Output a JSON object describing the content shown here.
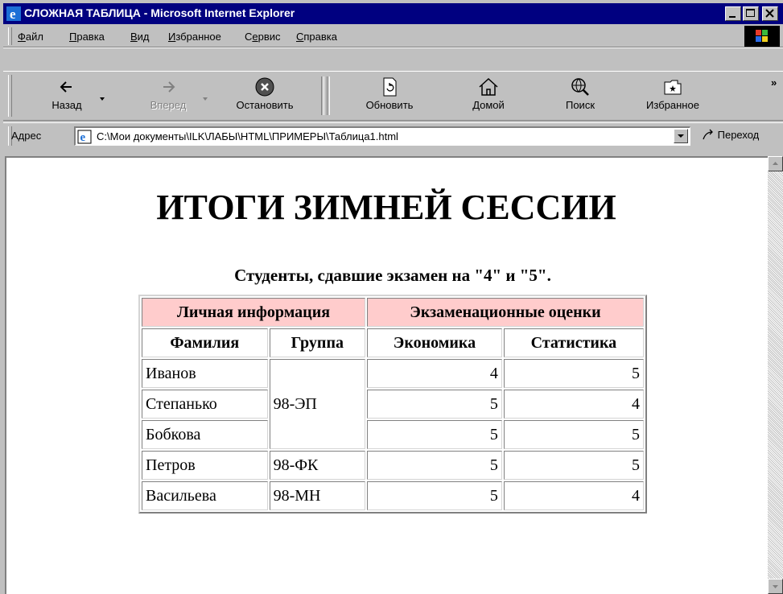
{
  "window": {
    "title": "СЛОЖНАЯ ТАБЛИЦА - Microsoft Internet Explorer"
  },
  "menu": [
    {
      "pre": "",
      "u": "Ф",
      "post": "айл"
    },
    {
      "pre": "",
      "u": "П",
      "post": "равка"
    },
    {
      "pre": "",
      "u": "В",
      "post": "ид"
    },
    {
      "pre": "",
      "u": "И",
      "post": "збранное"
    },
    {
      "pre": "С",
      "u": "е",
      "post": "рвис"
    },
    {
      "pre": "",
      "u": "С",
      "post": "правка"
    }
  ],
  "toolbar": {
    "back": "Назад",
    "forward": "Вперед",
    "stop": "Остановить",
    "refresh": "Обновить",
    "home": "Домой",
    "search": "Поиск",
    "favorites": "Избранное",
    "more": "»"
  },
  "address": {
    "label": "Адрес",
    "value": "C:\\Мои документы\\ILK\\ЛАБЫ\\HTML\\ПРИМЕРЫ\\Таблица1.html",
    "go": "Переход"
  },
  "page": {
    "heading": "ИТОГИ ЗИМНЕЙ СЕССИИ",
    "caption": "Студенты, сдавшие экзамен на \"4\" и \"5\".",
    "group_headers": [
      "Личная информация",
      "Экзаменационные оценки"
    ],
    "col_headers": [
      "Фамилия",
      "Группа",
      "Экономика",
      "Статистика"
    ],
    "rows": [
      {
        "name": "Иванов",
        "group": "98-ЭП",
        "economics": "4",
        "statistics": "5"
      },
      {
        "name": "Степанько",
        "group": "98-ЭП",
        "economics": "5",
        "statistics": "4"
      },
      {
        "name": "Бобкова",
        "group": "98-ЭП",
        "economics": "5",
        "statistics": "5"
      },
      {
        "name": "Петров",
        "group": "98-ФК",
        "economics": "5",
        "statistics": "5"
      },
      {
        "name": "Васильева",
        "group": "98-МН",
        "economics": "5",
        "statistics": "4"
      }
    ]
  },
  "colors": {
    "titlebar": "#000080",
    "header_bg": "#ffcccc",
    "chrome": "#c0c0c0"
  }
}
